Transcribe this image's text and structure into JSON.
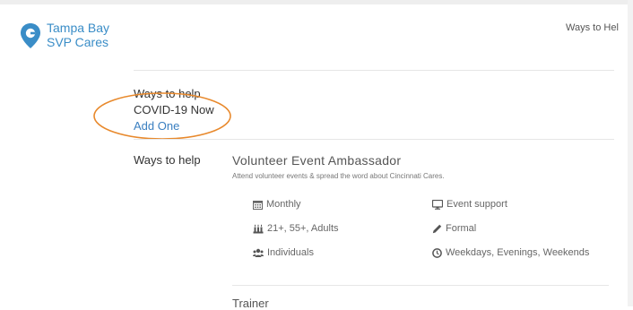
{
  "brand": {
    "line1": "Tampa Bay",
    "line2": "SVP Cares",
    "color": "#3a8dc7"
  },
  "header": {
    "nav_link": "Ways to Hel"
  },
  "sidebar": {
    "heading": "Ways to help",
    "items": [
      {
        "label": "COVID-19 Now"
      }
    ],
    "add_link": "Add One"
  },
  "section": {
    "label": "Ways to help",
    "cards": [
      {
        "title": "Volunteer Event Ambassador",
        "description": "Attend volunteer events & spread the word about Cincinnati Cares.",
        "attributes": [
          {
            "icon": "calendar-icon",
            "text": "Monthly"
          },
          {
            "icon": "monitor-icon",
            "text": "Event support"
          },
          {
            "icon": "people-age-icon",
            "text": "21+, 55+, Adults"
          },
          {
            "icon": "pencil-icon",
            "text": "Formal"
          },
          {
            "icon": "users-icon",
            "text": "Individuals"
          },
          {
            "icon": "clock-icon",
            "text": "Weekdays, Evenings, Weekends"
          }
        ]
      },
      {
        "title": "Trainer"
      }
    ]
  },
  "annotation": {
    "color": "#e8892c"
  }
}
